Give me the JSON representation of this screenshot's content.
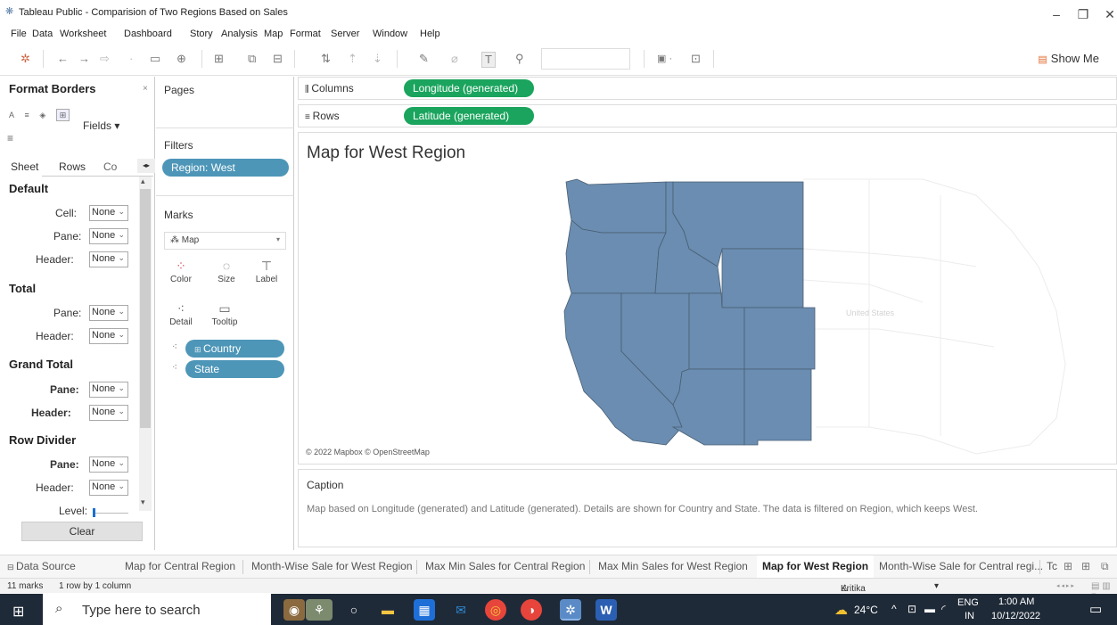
{
  "window": {
    "title": "Tableau Public - Comparision of Two Regions Based on Sales",
    "menu": [
      "File",
      "Data",
      "Worksheet",
      "Dashboard",
      "Story",
      "Analysis",
      "Map",
      "Format",
      "Server",
      "Window",
      "Help"
    ]
  },
  "toolbar": {
    "show_me": "Show Me"
  },
  "format_pane": {
    "title": "Format Borders",
    "fields_label": "Fields",
    "tabs": [
      "Sheet",
      "Rows",
      "Co"
    ],
    "sections": {
      "default": "Default",
      "total": "Total",
      "grand_total": "Grand Total",
      "row_divider": "Row Divider"
    },
    "labels": {
      "cell": "Cell:",
      "pane": "Pane:",
      "header": "Header:",
      "level": "Level:"
    },
    "select_value": "None",
    "clear": "Clear"
  },
  "cards": {
    "pages": "Pages",
    "filters": "Filters",
    "filter_pill": "Region: West",
    "marks": "Marks",
    "mark_type": "Map",
    "mark_buttons": [
      "Color",
      "Size",
      "Label",
      "Detail",
      "Tooltip"
    ],
    "detail_pills": [
      "Country",
      "State"
    ]
  },
  "shelves": {
    "columns_label": "Columns",
    "columns_pill": "Longitude (generated)",
    "rows_label": "Rows",
    "rows_pill": "Latitude (generated)"
  },
  "viz": {
    "title": "Map for West Region",
    "credit": "© 2022 Mapbox © OpenStreetMap",
    "map_label": "United States",
    "fill_color": "#6a8db1",
    "border_color": "#4a5e72"
  },
  "caption": {
    "title": "Caption",
    "text": "Map based on Longitude (generated) and Latitude (generated).  Details are shown for Country and State. The data is filtered on Region, which keeps West."
  },
  "sheet_tabs": [
    "Data Source",
    "Map for Central Region",
    "Month-Wise Sale for West Region",
    "Max Min Sales for Central Region",
    "Max Min Sales for West Region",
    "Map for West Region",
    "Month-Wise Sale for Central regi...",
    "Tc"
  ],
  "active_tab_index": 5,
  "status": {
    "marks": "11 marks",
    "dims": "1 row by 1 column",
    "user": "Kritika setia"
  },
  "taskbar": {
    "search_placeholder": "Type here to search",
    "weather": "24°C",
    "lang_top": "ENG",
    "lang_bottom": "IN",
    "time": "1:00 AM",
    "date": "10/12/2022"
  }
}
